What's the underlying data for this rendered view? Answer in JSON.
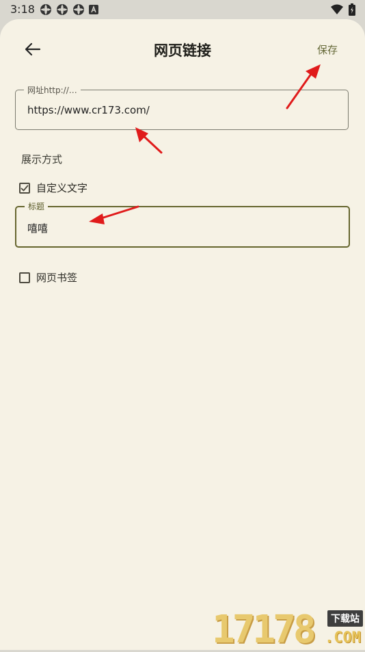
{
  "status_bar": {
    "time": "3:18",
    "left_icons": [
      "settings-icon",
      "settings-icon",
      "settings-icon",
      "a-badge-icon"
    ],
    "right_icons": [
      "wifi-icon",
      "battery-icon"
    ]
  },
  "header": {
    "back_icon": "arrow-left-icon",
    "title": "网页链接",
    "save_label": "保存"
  },
  "form": {
    "url_label": "网址http://…",
    "url_value": "https://www.cr173.com/",
    "display_mode_label": "展示方式",
    "custom_text": {
      "label": "自定义文字",
      "checked": true
    },
    "title_field": {
      "label": "标题",
      "value": "嘻嘻"
    },
    "bookmark": {
      "label": "网页书签",
      "checked": false
    }
  },
  "watermark": {
    "digits": "17178",
    "badge": "下载站",
    "com": ".COM"
  },
  "colors": {
    "background": "#f6f2e5",
    "accent": "#676b3a",
    "focused_border": "#65652d",
    "annotation_arrow": "#e01b1b"
  }
}
